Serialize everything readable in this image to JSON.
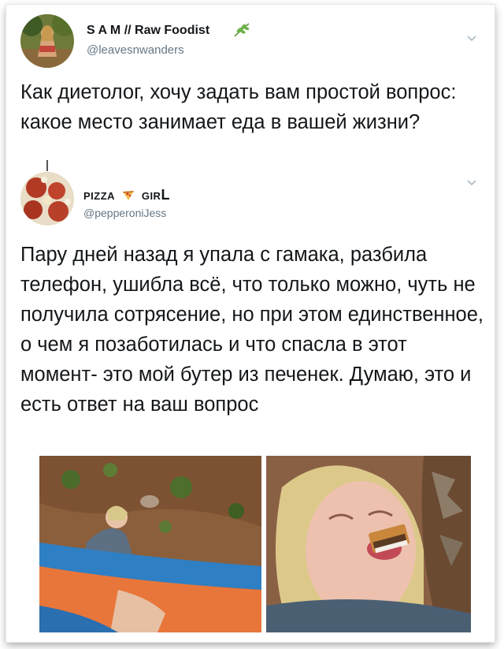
{
  "tweet1": {
    "name": "S A M // Raw Foodist",
    "handle": "@leavesnwanders",
    "text": "Как диетолог, хочу задать вам простой вопрос: какое место занимает еда в вашей жизни?",
    "icons": {
      "verified_like": "leaf-icon",
      "menu": "chevron-down-icon"
    }
  },
  "tweet2": {
    "name_part1": "PIZZA",
    "name_part2": "GIR",
    "name_part3": "L",
    "handle": "@pepperoniJess",
    "text": "Пару дней назад я упала с гамака, разбила телефон, ушибла всё, что только можно, чуть не получила сотрясение, но при этом единственное, о чем я позаботилась и что спасла в этот момент- это мой бутер из печенек. Думаю, это и есть ответ на ваш вопрос",
    "icons": {
      "name_emoji": "pizza-icon",
      "menu": "chevron-down-icon"
    }
  },
  "colors": {
    "text": "#14171a",
    "secondary": "#657786",
    "chevron": "#aab8c2",
    "hammock_blue": "#2f7fc4",
    "hammock_orange": "#e8763a"
  }
}
